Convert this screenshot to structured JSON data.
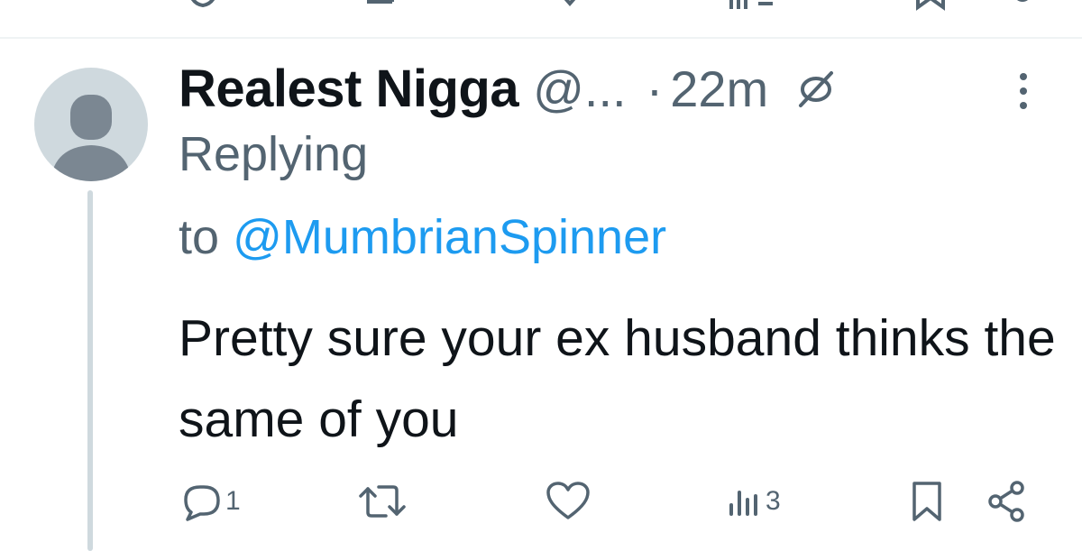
{
  "reply": {
    "author_name": "Realest Nigga",
    "handle": "@...",
    "separator": "·",
    "time": "22m",
    "replying_label": "Replying",
    "replying_to_prefix": "to",
    "replying_to_handle": "@MumbrianSpinner",
    "text": "Pretty sure your ex husband thinks the same of you"
  },
  "actions": {
    "replies": "1",
    "retweets": "",
    "likes": "",
    "views": "3"
  },
  "icons": {
    "avatar": "default-avatar-icon",
    "restricted": "no-replies-icon",
    "more": "more-vertical-icon",
    "reply": "reply-icon",
    "retweet": "retweet-icon",
    "like": "heart-icon",
    "views": "views-icon",
    "bookmark": "bookmark-icon",
    "share": "share-icon"
  },
  "colors": {
    "text": "#0f1419",
    "secondary": "#536471",
    "link": "#1d9bf0",
    "avatar_bg": "#cfd9de",
    "avatar_fg": "#7b8792"
  }
}
